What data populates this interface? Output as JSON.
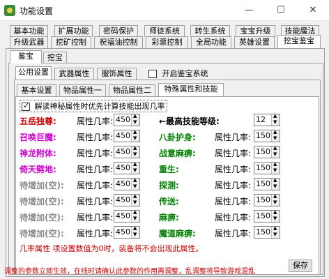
{
  "window": {
    "title": "功能设置",
    "minimize": "—",
    "maximize": "☐",
    "close": "✕"
  },
  "main_tabs_row1": [
    "基本功能",
    "扩展功能",
    "密码保护",
    "师徒系统",
    "转生系统",
    "宝宝升级",
    "技能魔法"
  ],
  "main_tabs_row2": [
    "升级武器",
    "挖矿控制",
    "祝福油控制",
    "彩票控制",
    "全局功能",
    "英雄设置",
    "挖宝鉴宝"
  ],
  "sub_tabs": [
    "鉴宝",
    "挖宝"
  ],
  "cat_tabs": [
    "公用设置",
    "武器属性",
    "服饰属性"
  ],
  "enable_label": "开启鉴宝系统",
  "inner_tabs": [
    "基本设置",
    "物品属性一",
    "物品属性二",
    "特殊属性和技能"
  ],
  "priority_label": "解读神秘属性时优先计算技能出现几率",
  "rate_label": "属性几率:",
  "max_skill": {
    "label": "←最高技能等级:",
    "value": "12"
  },
  "left_items": [
    {
      "name": "五岳独尊:",
      "value": "450"
    },
    {
      "name": "召唤巨魔:",
      "value": "450"
    },
    {
      "name": "神龙附体:",
      "value": "450"
    },
    {
      "name": "倚天劈地:",
      "value": "450"
    },
    {
      "name": "待增加(空):",
      "value": "450"
    },
    {
      "name": "待增加(空):",
      "value": "450"
    },
    {
      "name": "待增加(空):",
      "value": "450"
    },
    {
      "name": "待增加(空):",
      "value": "450"
    }
  ],
  "right_items": [
    {
      "name": "八卦护身:",
      "value": "150"
    },
    {
      "name": "战意麻痹:",
      "value": "150"
    },
    {
      "name": "重生:",
      "value": "150"
    },
    {
      "name": "探测:",
      "value": "150"
    },
    {
      "name": "传送:",
      "value": "150"
    },
    {
      "name": "麻痹:",
      "value": "150"
    },
    {
      "name": "魔道麻痹:",
      "value": "150"
    }
  ],
  "note_inner": "几率属性 项设置数值为0时，装备将不会出现此属性。",
  "save_label": "保存",
  "footer_note": "调整的参数立即生效，在线时请确认此参数的作用再调整，乱调整将导致游戏混乱",
  "colors": {
    "red": "#cc0000",
    "magenta": "#d000d0",
    "green": "#008000",
    "gray": "#8a8a8a"
  }
}
